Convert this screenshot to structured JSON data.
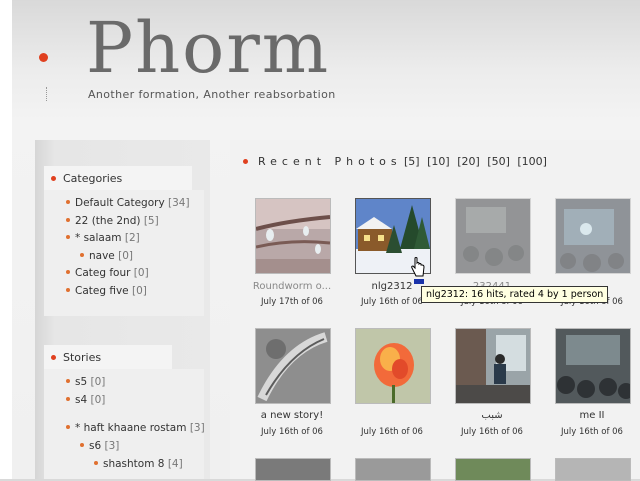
{
  "header": {
    "title": "Phorm",
    "tagline": "Another formation, Another reabsorbation"
  },
  "sidebar": {
    "categories": {
      "title": "Categories",
      "items": [
        {
          "label": "Default Category",
          "count": "[34]"
        },
        {
          "label": "22 (the 2nd)",
          "count": "[5]"
        },
        {
          "label": "* salaam",
          "count": "[2]"
        },
        {
          "label": "nave",
          "count": "[0]"
        },
        {
          "label": "Categ four",
          "count": "[0]"
        },
        {
          "label": "Categ five",
          "count": "[0]"
        }
      ]
    },
    "stories": {
      "title": "Stories",
      "items": [
        {
          "label": "s5",
          "count": "[0]"
        },
        {
          "label": "s4",
          "count": "[0]"
        },
        {
          "label": "* haft khaane rostam",
          "count": "[3]"
        },
        {
          "label": "s6",
          "count": "[3]"
        },
        {
          "label": "shashtom 8",
          "count": "[4]"
        }
      ]
    }
  },
  "photos": {
    "heading": "Recent Photos",
    "links": [
      "[5]",
      "[10]",
      "[20]",
      "[50]",
      "[100]"
    ],
    "items": [
      {
        "name": "Roundworm o...",
        "date": "July 17th of 06",
        "icon": "icicle-branch-photo"
      },
      {
        "name": "nlg2312",
        "date": "July 16th of 06",
        "icon": "snow-house-photo"
      },
      {
        "name": "232441",
        "date": "July 16th of 06",
        "icon": "dark-room-photo"
      },
      {
        "name": "",
        "date": "July 16th of 06",
        "icon": "projector-photo"
      },
      {
        "name": "a new story!",
        "date": "July 16th of 06",
        "icon": "bw-leaf-photo"
      },
      {
        "name": "July 16th of 06",
        "date": "July 16th of 06",
        "icon": "rose-photo"
      },
      {
        "name": "شبب",
        "date": "July 16th of 06",
        "icon": "person-photo"
      },
      {
        "name": "me II",
        "date": "July 16th of 06",
        "icon": "audience-photo"
      }
    ],
    "tooltip": "nlg2312: 16 hits, rated 4 by 1 person"
  },
  "colors": {
    "accent": "#e0401f",
    "tooltip_bg": "#ffffe1"
  }
}
